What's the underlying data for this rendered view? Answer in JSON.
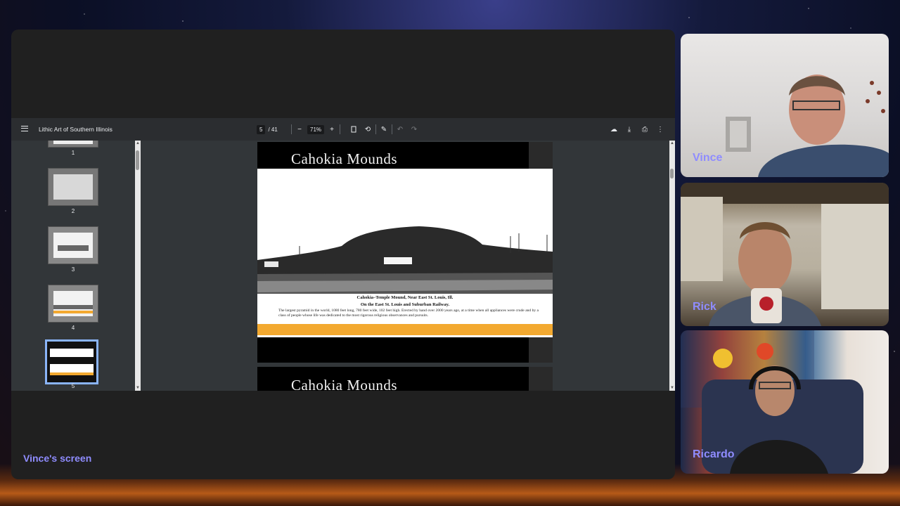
{
  "pdf": {
    "title": "Lithic Art of Southern Illinois",
    "current_page": "5",
    "page_total": "/ 41",
    "zoom": "71%",
    "thumbnails": [
      "1",
      "2",
      "3",
      "4",
      "5"
    ],
    "selected_thumbnail": "5"
  },
  "page_content": {
    "title": "Cahokia Mounds",
    "caption_line1": "Cahokia–Temple Mound, Near East St. Louis, Ill.",
    "caption_line2": "On the East St. Louis and Suburban Railway.",
    "caption_body": "The largest pyramid in the world, 1080 feet long, 780 feet wide, 102 feet high. Erected by hand over 2000 years ago, at a time when all appliances were crude and by a class of people whose life was dedicated to the most rigorous religious observances and pursuits.",
    "next_page_title": "Cahokia Mounds"
  },
  "share": {
    "label": "Vince's screen"
  },
  "participants": [
    {
      "name": "Vince"
    },
    {
      "name": "Rick"
    },
    {
      "name": "Ricardo"
    }
  ],
  "colors": {
    "accent": "#8f8cff",
    "toolbar": "#2b2d30",
    "viewer_bg": "#323639",
    "selected_thumb": "#8ab4f8",
    "band": "#f3a930"
  }
}
